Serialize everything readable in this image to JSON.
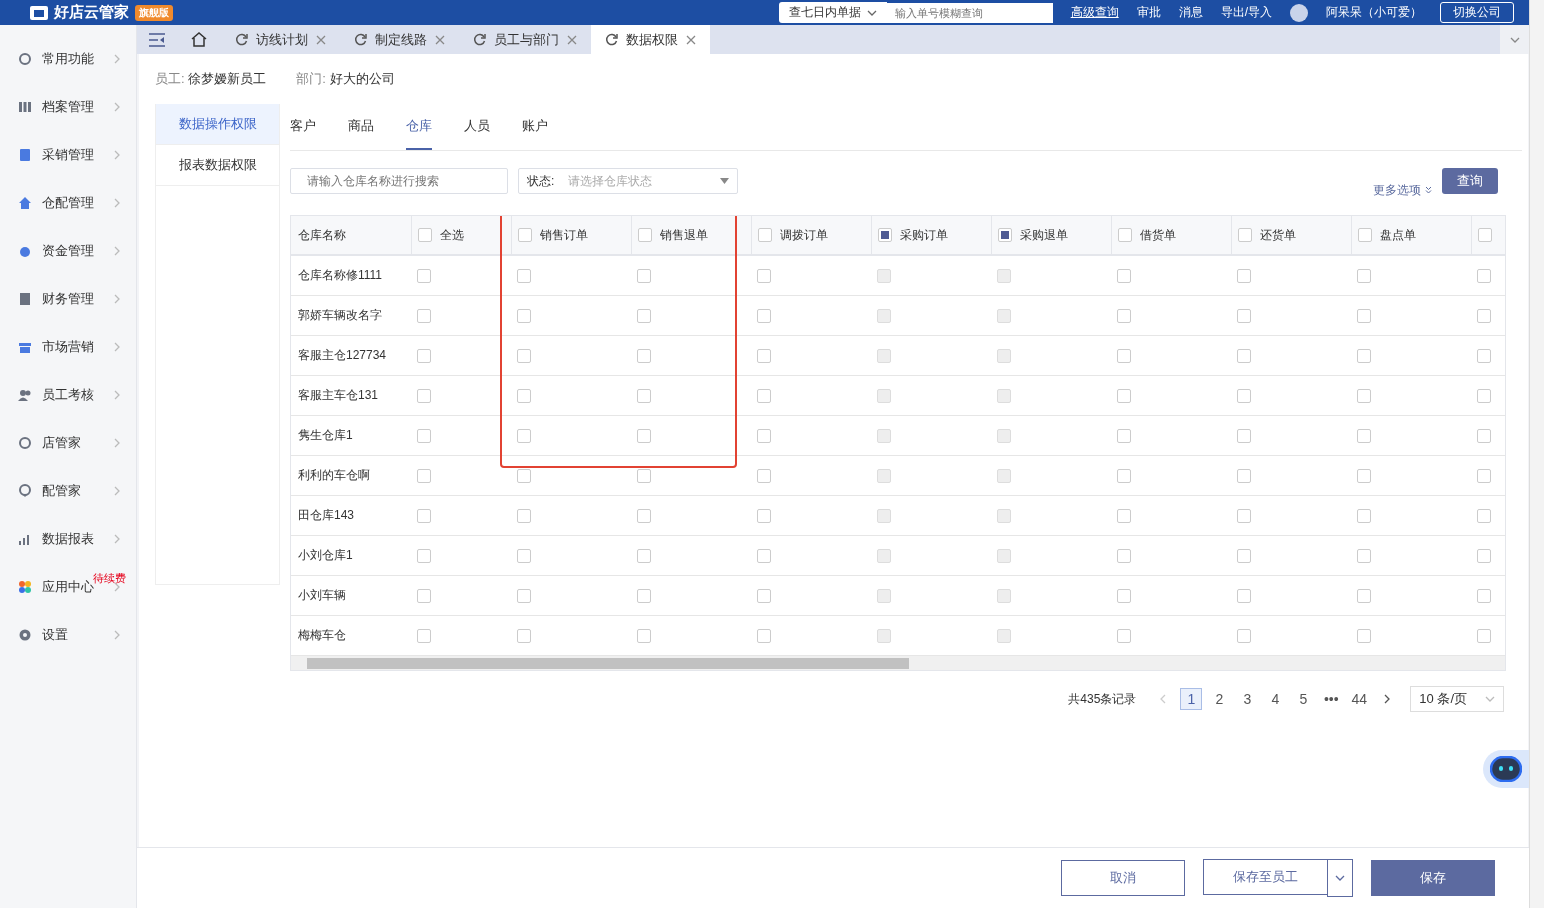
{
  "header": {
    "brand": "好店云管家",
    "edition": "旗舰版",
    "date_filter": "查七日内单据",
    "search": {
      "placeholder": "输入单号模糊查询"
    },
    "links": [
      "高级查询",
      "审批",
      "消息",
      "导出/导入"
    ],
    "user": "阿呆呆（小可爱）",
    "switch_button": "切换公司"
  },
  "sidebar": {
    "items": [
      {
        "label": "常用功能"
      },
      {
        "label": "档案管理"
      },
      {
        "label": "采销管理"
      },
      {
        "label": "仓配管理"
      },
      {
        "label": "资金管理"
      },
      {
        "label": "财务管理"
      },
      {
        "label": "市场营销"
      },
      {
        "label": "员工考核"
      },
      {
        "label": "店管家"
      },
      {
        "label": "配管家"
      },
      {
        "label": "数据报表"
      },
      {
        "label": "应用中心",
        "badge": "待续费"
      },
      {
        "label": "设置"
      }
    ]
  },
  "tabs": [
    {
      "label": "访线计划",
      "selected": false
    },
    {
      "label": "制定线路",
      "selected": false
    },
    {
      "label": "员工与部门",
      "selected": false
    },
    {
      "label": "数据权限",
      "selected": true
    }
  ],
  "info": {
    "employee_label": "员工:",
    "employee": "徐梦嫒新员工",
    "department_label": "部门:",
    "department": "好大的公司"
  },
  "side_menu": [
    {
      "label": "数据操作权限",
      "selected": true
    },
    {
      "label": "报表数据权限",
      "selected": false
    }
  ],
  "sub_tabs": [
    {
      "label": "客户",
      "selected": false
    },
    {
      "label": "商品",
      "selected": false
    },
    {
      "label": "仓库",
      "selected": true
    },
    {
      "label": "人员",
      "selected": false
    },
    {
      "label": "账户",
      "selected": false
    }
  ],
  "filters": {
    "search": {
      "placeholder": "请输入仓库名称进行搜索"
    },
    "status": {
      "label": "状态:",
      "placeholder": "请选择仓库状态"
    },
    "more_options": "更多选项",
    "query_button": "查询"
  },
  "table": {
    "name_column": "仓库名称",
    "columns": [
      {
        "label": "全选",
        "checked": false
      },
      {
        "label": "销售订单",
        "checked": false
      },
      {
        "label": "销售退单",
        "checked": false
      },
      {
        "label": "调拨订单",
        "checked": false
      },
      {
        "label": "采购订单",
        "checked": true
      },
      {
        "label": "采购退单",
        "checked": true
      },
      {
        "label": "借货单",
        "checked": false
      },
      {
        "label": "还货单",
        "checked": false
      },
      {
        "label": "盘点单",
        "checked": false
      },
      {
        "checked": false
      }
    ],
    "rows": [
      {
        "name": "仓库名称修1111"
      },
      {
        "name": "郭娇车辆改名字"
      },
      {
        "name": "客服主仓127734"
      },
      {
        "name": "客服主车仓131"
      },
      {
        "name": "隽生仓库1"
      },
      {
        "name": "利利的车仓啊"
      },
      {
        "name": "田仓库143"
      },
      {
        "name": "小刘仓库1"
      },
      {
        "name": "小刘车辆"
      },
      {
        "name": "梅梅车仓"
      }
    ]
  },
  "pagination": {
    "total": "共435条记录",
    "pages": [
      {
        "label": "1",
        "selected": true
      },
      {
        "label": "2",
        "selected": false
      },
      {
        "label": "3",
        "selected": false
      },
      {
        "label": "4",
        "selected": false
      },
      {
        "label": "5",
        "selected": false
      },
      {
        "label": "•••",
        "selected": false
      },
      {
        "label": "44",
        "selected": false
      }
    ],
    "page_size": "10 条/页"
  },
  "footer": {
    "cancel": "取消",
    "save_to_employee": "保存至员工",
    "save": "保存"
  }
}
